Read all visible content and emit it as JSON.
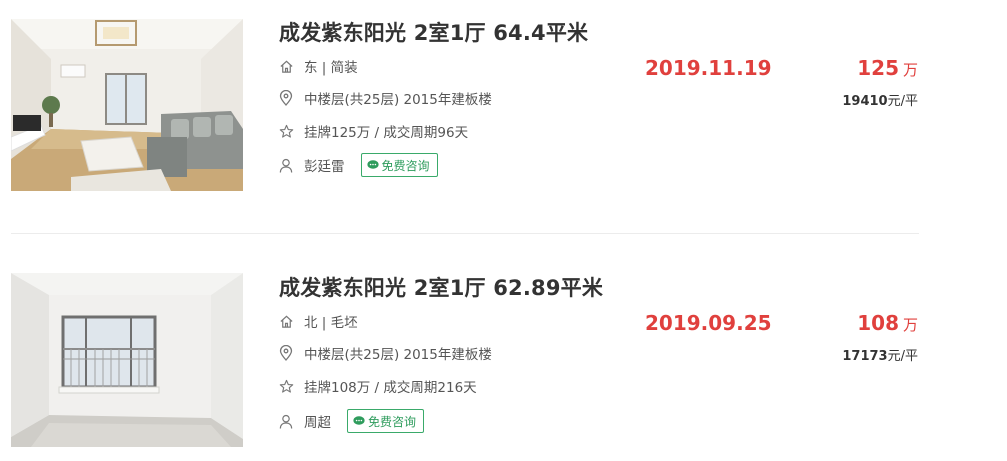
{
  "listings": [
    {
      "title": "成发紫东阳光 2室1厅 64.4平米",
      "house_info": "东 | 简装",
      "position_info": "中楼层(共25层) 2015年建板楼",
      "deal_cycle": "挂牌125万 / 成交周期96天",
      "agent_name": "彭廷雷",
      "consult_label": "免费咨询",
      "deal_date": "2019.11.19",
      "total_price": "125",
      "total_price_unit": "万",
      "unit_price": "19410",
      "unit_price_unit": "元/平"
    },
    {
      "title": "成发紫东阳光 2室1厅 62.89平米",
      "house_info": "北 | 毛坯",
      "position_info": "中楼层(共25层) 2015年建板楼",
      "deal_cycle": "挂牌108万 / 成交周期216天",
      "agent_name": "周超",
      "consult_label": "免费咨询",
      "deal_date": "2019.09.25",
      "total_price": "108",
      "total_price_unit": "万",
      "unit_price": "17173",
      "unit_price_unit": "元/平"
    }
  ],
  "colors": {
    "accent_red": "#e0403d",
    "consult_green": "#2f9c5d",
    "text_dark": "#333333",
    "text_muted": "#555555"
  },
  "icons": {
    "house_info": "home-icon",
    "position_info": "location-pin-icon",
    "deal_cycle": "star-icon",
    "agent": "person-icon",
    "consult": "chat-bubble-icon"
  }
}
